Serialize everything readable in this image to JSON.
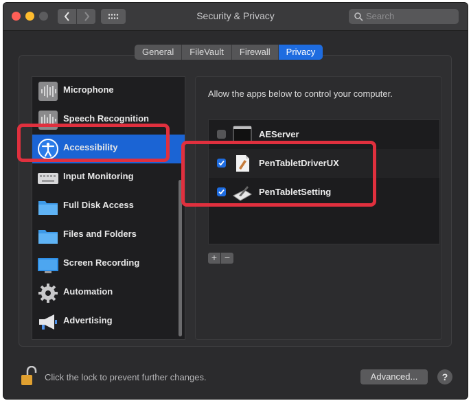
{
  "window": {
    "title": "Security & Privacy"
  },
  "toolbar": {
    "back_icon": "chevron-left-icon",
    "forward_icon": "chevron-right-icon",
    "grid_icon": "grid-icon"
  },
  "search": {
    "placeholder": "Search"
  },
  "tabs": [
    {
      "label": "General",
      "active": false
    },
    {
      "label": "FileVault",
      "active": false
    },
    {
      "label": "Firewall",
      "active": false
    },
    {
      "label": "Privacy",
      "active": true
    }
  ],
  "sidebar": {
    "items": [
      {
        "label": "Microphone",
        "icon": "microphone-icon"
      },
      {
        "label": "Speech Recognition",
        "icon": "speech-recognition-icon"
      },
      {
        "label": "Accessibility",
        "icon": "accessibility-icon",
        "selected": true
      },
      {
        "label": "Input Monitoring",
        "icon": "keyboard-icon"
      },
      {
        "label": "Full Disk Access",
        "icon": "folder-icon"
      },
      {
        "label": "Files and Folders",
        "icon": "folder-icon"
      },
      {
        "label": "Screen Recording",
        "icon": "display-icon"
      },
      {
        "label": "Automation",
        "icon": "gear-icon"
      },
      {
        "label": "Advertising",
        "icon": "megaphone-icon"
      }
    ]
  },
  "main": {
    "header": "Allow the apps below to control your computer.",
    "apps": [
      {
        "name": "AEServer",
        "checked": false,
        "icon": "terminal-icon"
      },
      {
        "name": "PenTabletDriverUX",
        "checked": true,
        "icon": "pen-tablet-driver-icon"
      },
      {
        "name": "PenTabletSetting",
        "checked": true,
        "icon": "pen-tablet-setting-icon"
      }
    ],
    "add_label": "+",
    "remove_label": "−"
  },
  "footer": {
    "lock_text": "Click the lock to prevent further changes.",
    "advanced_label": "Advanced...",
    "help_label": "?"
  },
  "colors": {
    "accent": "#1e6ce0",
    "highlight": "#e0303e"
  }
}
